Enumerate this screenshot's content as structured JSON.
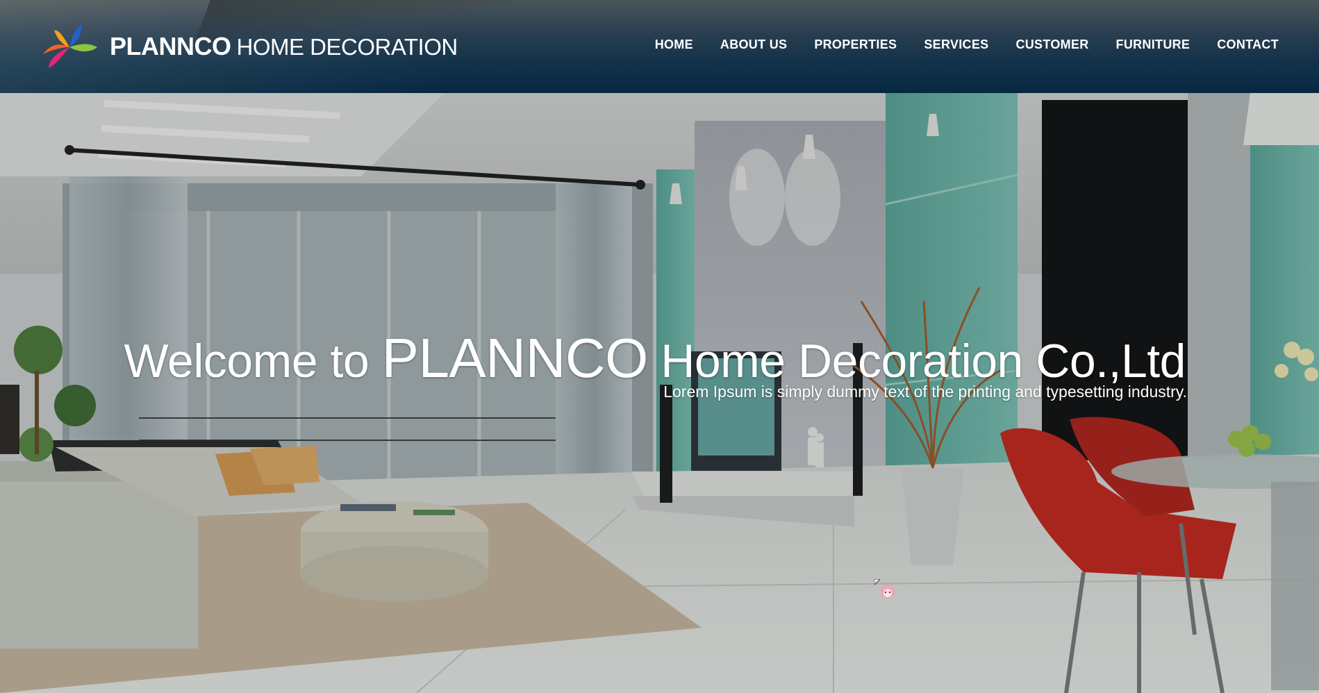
{
  "brand": {
    "name_strong": "PLANNCO",
    "name_light": "HOME DECORATION",
    "logo_icon": "pinwheel-logo-icon"
  },
  "nav": {
    "items": [
      "HOME",
      "ABOUT US",
      "PROPERTIES",
      "SERVICES",
      "CUSTOMER",
      "FURNITURE",
      "CONTACT"
    ]
  },
  "hero": {
    "title_pre": "Welcome to ",
    "title_brand": "PLANNCO",
    "title_post": " Home Decoration Co.,Ltd",
    "subtitle": "Lorem Ipsum is simply dummy text of the printing and typesetting industry."
  },
  "colors": {
    "header_top": "#4b5659",
    "header_bottom": "#062841",
    "text": "#ffffff",
    "chair_red": "#c8281e",
    "wall_teal": "#6fb5aa"
  }
}
